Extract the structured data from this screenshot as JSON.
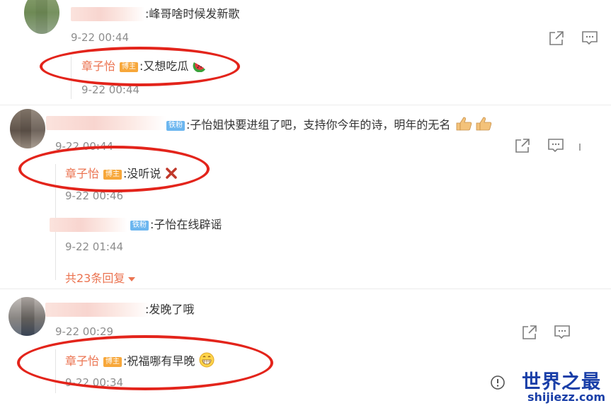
{
  "comments": [
    {
      "text": ":峰哥啥时候发新歌",
      "time": "9-22 00:44",
      "reply": {
        "author": "章子怡",
        "badge": "博主",
        "text": ":又想吃瓜",
        "emoji": "watermelon-emoji",
        "time": "9-22 00:44"
      }
    },
    {
      "fan_badge": "铁粉",
      "text": ":子怡姐快要进组了吧，支持你今年的诗，明年的无名",
      "emoji": "thumbs-up-emoji",
      "time": "9-22 00:44",
      "reply": {
        "author": "章子怡",
        "badge": "博主",
        "text": ":没听说",
        "emoji": "cross-mark-emoji",
        "time": "9-22 00:46"
      },
      "reply2": {
        "fan_badge": "铁粉",
        "text": ":子怡在线辟谣",
        "time": "9-22 01:44"
      },
      "more_replies": "共23条回复"
    },
    {
      "text": ":发晚了哦",
      "time": "9-22 00:29",
      "reply": {
        "author": "章子怡",
        "badge": "博主",
        "text": ":祝福哪有早晚",
        "emoji": "grinning-face-emoji",
        "time": "9-22 00:34"
      }
    }
  ],
  "watermark": {
    "title": "世界之最",
    "url": "shijiezz.com"
  },
  "colors": {
    "author": "#eb7350",
    "host_badge": "#f7a73a",
    "fan_badge": "#6cb6ef",
    "annotation_circle": "#e3241b",
    "watermark": "#1a3fa8"
  }
}
